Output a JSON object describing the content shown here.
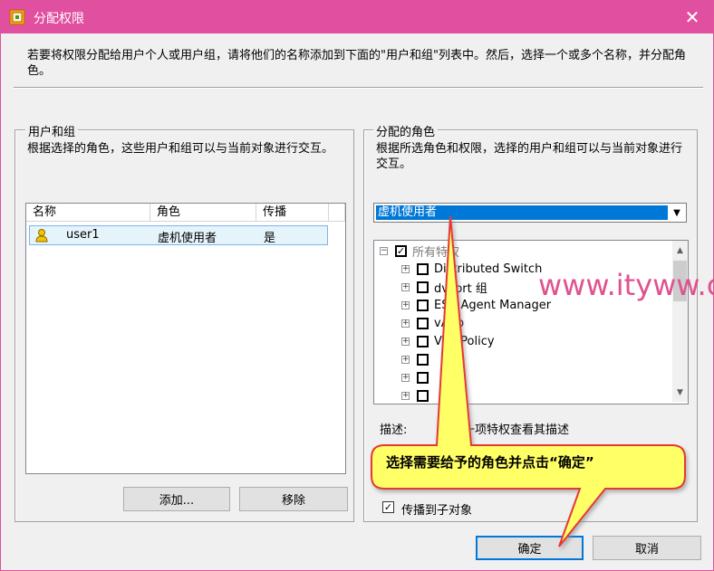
{
  "window": {
    "title": "分配权限",
    "close_symbol": "✕"
  },
  "intro": "若要将权限分配给用户个人或用户组，请将他们的名称添加到下面的\"用户和组\"列表中。然后，选择一个或多个名称，并分配角色。",
  "users_groups": {
    "legend": "用户和组",
    "description": "根据选择的角色，这些用户和组可以与当前对象进行交互。",
    "columns": [
      "名称",
      "角色",
      "传播"
    ],
    "rows": [
      {
        "name": "user1",
        "role": "虚机使用者",
        "propagate": "是"
      }
    ],
    "add_button": "添加...",
    "remove_button": "移除"
  },
  "assigned_role": {
    "legend": "分配的角色",
    "description": "根据所选角色和权限，选择的用户和组可以与当前对象进行交互。",
    "selected_role": "虚机使用者",
    "tree": {
      "root_label": "所有特权",
      "items": [
        "Distributed Switch",
        "dvPort 组",
        "ESX Agent Manager",
        "vApp",
        "VRMPolicy",
        "",
        "",
        ""
      ]
    },
    "description_label": "描述:",
    "description_value": "选择一项特权查看其描述",
    "propagate_label": "传播到子对象"
  },
  "buttons": {
    "ok": "确定",
    "cancel": "取消"
  },
  "annotation": {
    "callout_text": "选择需要给予的角色并点击“确定”",
    "watermark": "www.ityww.cn"
  },
  "colors": {
    "titlebar": "#e14fa0",
    "selection": "#0078d7",
    "callout_fill": "#ffff66",
    "callout_border": "#e53935"
  }
}
